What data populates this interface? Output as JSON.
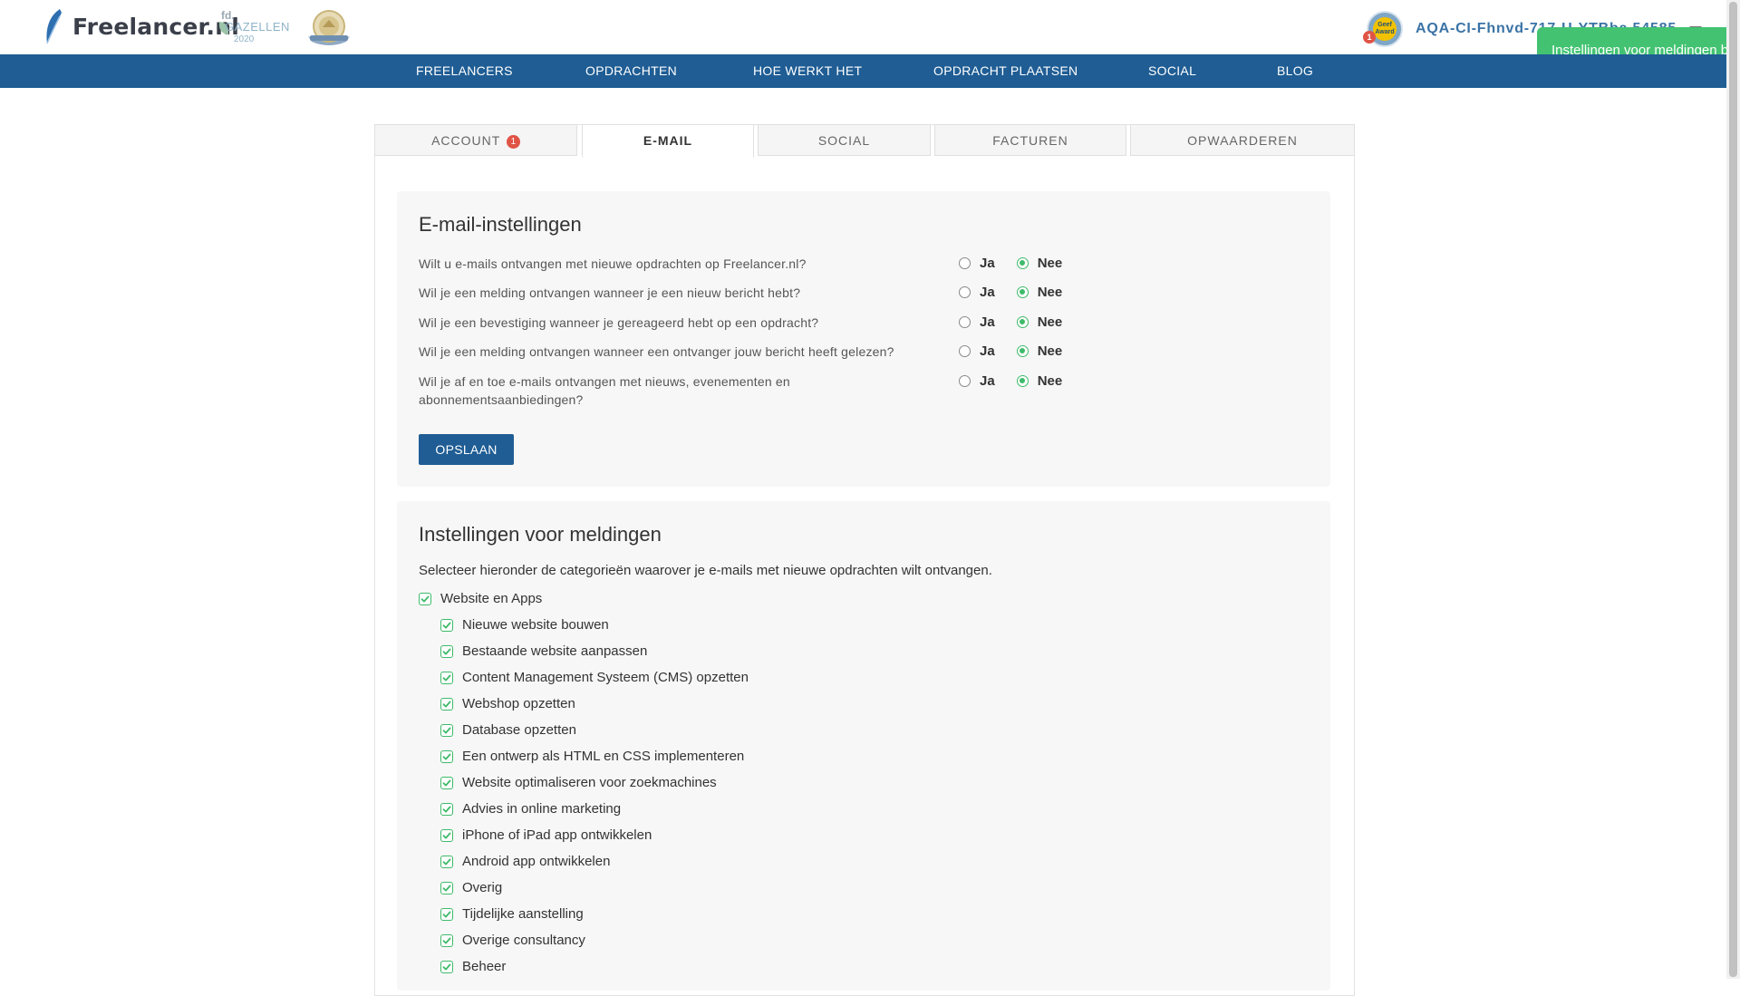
{
  "header": {
    "brand": "Freelancer.nl",
    "award_gazellen": {
      "line1": "fd.",
      "line2": "GAZELLEN",
      "line3": "2020"
    },
    "avatar_text": "Geef Award",
    "avatar_badge": "1",
    "username": "AQA-CI-Fhnvd-717-U-YTBba 54585",
    "toast": "Instellingen voor meldingen bijgewerkt"
  },
  "nav": {
    "items": [
      "FREELANCERS",
      "OPDRACHTEN",
      "HOE WERKT HET",
      "OPDRACHT PLAATSEN",
      "SOCIAL",
      "BLOG"
    ]
  },
  "tabs": {
    "items": [
      {
        "label": "ACCOUNT",
        "badge": "1"
      },
      {
        "label": "E-MAIL"
      },
      {
        "label": "SOCIAL"
      },
      {
        "label": "FACTUREN"
      },
      {
        "label": "OPWAARDEREN"
      }
    ],
    "active": "E-MAIL"
  },
  "email_settings": {
    "title": "E-mail-instellingen",
    "yes_label": "Ja",
    "no_label": "Nee",
    "questions": [
      {
        "text": "Wilt u e-mails ontvangen met nieuwe opdrachten op Freelancer.nl?",
        "value": "Nee"
      },
      {
        "text": "Wil je een melding ontvangen wanneer je een nieuw bericht hebt?",
        "value": "Nee"
      },
      {
        "text": "Wil je een bevestiging wanneer je gereageerd hebt op een opdracht?",
        "value": "Nee"
      },
      {
        "text": "Wil je een melding ontvangen wanneer een ontvanger jouw bericht heeft gelezen?",
        "value": "Nee"
      },
      {
        "text": "Wil je af en toe e-mails ontvangen met nieuws, evenementen en abonnementsaanbiedingen?",
        "value": "Nee"
      }
    ],
    "save_label": "OPSLAAN"
  },
  "notification_settings": {
    "title": "Instellingen voor meldingen",
    "intro": "Selecteer hieronder de categorieën waarover je e-mails met nieuwe opdrachten wilt ontvangen.",
    "parent_category": {
      "label": "Website en Apps",
      "checked": true
    },
    "subcategories": [
      {
        "label": "Nieuwe website bouwen",
        "checked": true
      },
      {
        "label": "Bestaande website aanpassen",
        "checked": true
      },
      {
        "label": "Content Management Systeem (CMS) opzetten",
        "checked": true
      },
      {
        "label": "Webshop opzetten",
        "checked": true
      },
      {
        "label": "Database opzetten",
        "checked": true
      },
      {
        "label": "Een ontwerp als HTML en CSS implementeren",
        "checked": true
      },
      {
        "label": "Website optimaliseren voor zoekmachines",
        "checked": true
      },
      {
        "label": "Advies in online marketing",
        "checked": true
      },
      {
        "label": "iPhone of iPad app ontwikkelen",
        "checked": true
      },
      {
        "label": "Android app ontwikkelen",
        "checked": true
      },
      {
        "label": "Overig",
        "checked": true
      },
      {
        "label": "Tijdelijke aanstelling",
        "checked": true
      },
      {
        "label": "Overige consultancy",
        "checked": true
      },
      {
        "label": "Beheer",
        "checked": true
      }
    ]
  },
  "colors": {
    "nav_bg": "#1f5d94",
    "accent_green": "#3fba6a",
    "username_blue": "#3a73a6",
    "badge_red": "#e05445",
    "toast_green": "#43c372"
  }
}
